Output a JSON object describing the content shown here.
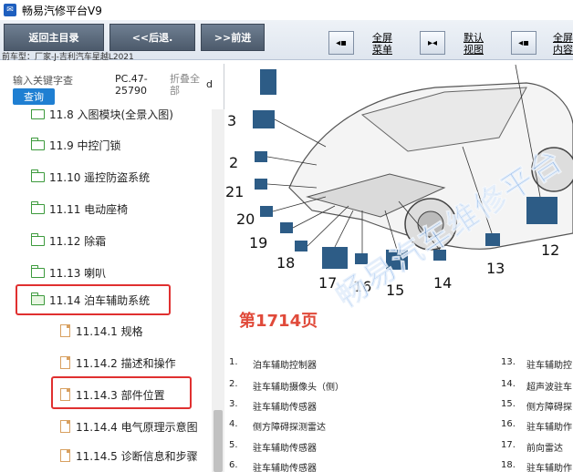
{
  "window": {
    "title": "畅易汽修平台V9",
    "icon": "app-icon"
  },
  "toolbar": {
    "back_home": "返回主目录",
    "back": "<<后退.",
    "forward": ">>前进",
    "view_buttons": [
      {
        "label1": "全屏",
        "label2": "菜单",
        "icon": "fullscreen-menu-icon"
      },
      {
        "label1": "默认",
        "label2": "视图",
        "icon": "default-view-icon"
      },
      {
        "label1": "全屏",
        "label2": "内容",
        "icon": "fullscreen-content-icon"
      }
    ]
  },
  "info": {
    "current_vehicle": "前车型：厂家-J-吉利汽车星越L2021"
  },
  "search": {
    "placeholder": "输入关键字查",
    "query_label": "查询",
    "doc_code_line1": "PC.47-",
    "doc_code_line2": "25790",
    "collapse_line1": "折叠全",
    "collapse_line2": "部",
    "collapse_extra": "d"
  },
  "tree": [
    {
      "label": "11.8 入图模块(全景入图)",
      "type": "folder"
    },
    {
      "label": "11.9 中控门锁",
      "type": "folder"
    },
    {
      "label": "11.10 遥控防盗系统",
      "type": "folder"
    },
    {
      "label": "11.11 电动座椅",
      "type": "folder"
    },
    {
      "label": "11.12 除霜",
      "type": "folder"
    },
    {
      "label": "11.13 喇叭",
      "type": "folder"
    },
    {
      "label": "11.14 泊车辅助系统",
      "type": "folder-open",
      "highlighted": true
    },
    {
      "label": "11.14.1 规格",
      "type": "page"
    },
    {
      "label": "11.14.2 描述和操作",
      "type": "page"
    },
    {
      "label": "11.14.3 部件位置",
      "type": "page",
      "highlighted": true
    },
    {
      "label": "11.14.4 电气原理示意图",
      "type": "page"
    },
    {
      "label": "11.14.5 诊断信息和步骤",
      "type": "page"
    }
  ],
  "content": {
    "page_label": "第1714页",
    "watermark": "畅易汽车维修平台",
    "callouts": [
      "3",
      "2",
      "21",
      "20",
      "19",
      "18",
      "17",
      "16",
      "15",
      "14",
      "13",
      "12"
    ],
    "legend_left": [
      {
        "num": "1.",
        "text": "泊车辅助控制器"
      },
      {
        "num": "2.",
        "text": "驻车辅助摄像头（侧）"
      },
      {
        "num": "3.",
        "text": "驻车辅助传感器"
      },
      {
        "num": "4.",
        "text": "侧方障碍探测雷达"
      },
      {
        "num": "5.",
        "text": "驻车辅助传感器"
      },
      {
        "num": "6.",
        "text": "驻车辅助传感器"
      }
    ],
    "legend_right": [
      {
        "num": "13.",
        "text": "驻车辅助控"
      },
      {
        "num": "14.",
        "text": "超声波驻车"
      },
      {
        "num": "15.",
        "text": "侧方障碍探"
      },
      {
        "num": "16.",
        "text": "驻车辅助作"
      },
      {
        "num": "17.",
        "text": "前向雷达"
      },
      {
        "num": "18.",
        "text": "驻车辅助作"
      }
    ]
  },
  "colors": {
    "highlight": "#e03030",
    "page_number": "#e04a3a",
    "query_button": "#1f7fd2"
  }
}
